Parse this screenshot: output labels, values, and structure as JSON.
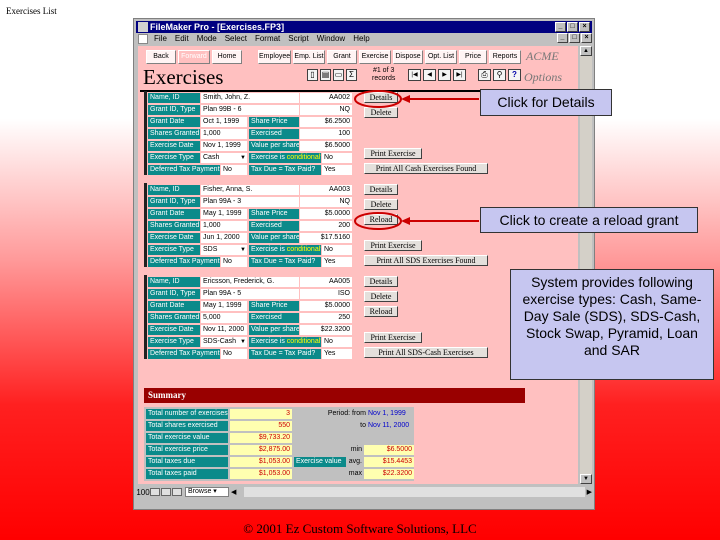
{
  "slide": {
    "title": "Exercises List",
    "footer": "© 2001 Ez Custom Software Solutions, LLC"
  },
  "window": {
    "title": "FileMaker Pro - [Exercises.FP3]",
    "menu": [
      "File",
      "Edit",
      "Mode",
      "Select",
      "Format",
      "Script",
      "Window",
      "Help"
    ],
    "window_buttons": [
      "_",
      "□",
      "×"
    ]
  },
  "toolbar": {
    "back": "Back",
    "forward": "Forward",
    "home": "Home",
    "tabs": [
      "Employee",
      "Emp. List",
      "Grant",
      "Exercise",
      "Dispose",
      "Opt. List",
      "Price",
      "Reports"
    ],
    "brand": "ACME",
    "options": "Options",
    "heading": "Exercises",
    "record_info_line1": "#1 of 3",
    "record_info_line2": "records",
    "doc_icons": [
      "new-record",
      "duplicate",
      "delete",
      "sum"
    ],
    "nav_icons": [
      "first",
      "prev",
      "next",
      "last"
    ],
    "tool_icons": [
      "print",
      "find",
      "help"
    ]
  },
  "labels": {
    "name_id": "Name, ID",
    "grant_id_type": "Grant ID, Type",
    "grant_date": "Grant Date",
    "share_price": "Share Price",
    "shares_granted": "Shares Granted",
    "exercised": "Exercised",
    "exercise_date": "Exercise Date",
    "value_per_share": "Value per share",
    "exercise_type": "Exercise Type",
    "exercise_is": "Exercise is ",
    "conditional": "conditional?",
    "deferred_tax": "Deferred Tax Payment?",
    "tax_due": "Tax Due = Tax Paid?"
  },
  "buttons": {
    "details": "Details",
    "delete": "Delete",
    "reload": "Reload",
    "print_exercise": "Print Exercise"
  },
  "records": [
    {
      "name": "Smith, John, Z.",
      "id": "AA002",
      "grant_id": "Plan 99B - 6",
      "type": "NQ",
      "grant_date": "Oct 1, 1999",
      "share_price": "$6.2500",
      "shares_granted": "1,000",
      "exercised": "100",
      "exercise_date": "Nov 1, 1999",
      "value_per_share": "$6.5000",
      "exercise_type": "Cash",
      "conditional": "No",
      "deferred": "No",
      "tax_due": "Yes",
      "print_all": "Print All Cash Exercises Found",
      "has_reload": false
    },
    {
      "name": "Fisher, Anna, S.",
      "id": "AA003",
      "grant_id": "Plan 99A - 3",
      "type": "NQ",
      "grant_date": "May 1, 1999",
      "share_price": "$5.0000",
      "shares_granted": "1,000",
      "exercised": "200",
      "exercise_date": "Jun 1, 2000",
      "value_per_share": "$17.5160",
      "exercise_type": "SDS",
      "conditional": "No",
      "deferred": "No",
      "tax_due": "Yes",
      "print_all": "Print All SDS Exercises Found",
      "has_reload": true
    },
    {
      "name": "Ericsson, Frederick, G.",
      "id": "AA005",
      "grant_id": "Plan 99A - 5",
      "type": "ISO",
      "grant_date": "May 1, 1999",
      "share_price": "$5.0000",
      "shares_granted": "5,000",
      "exercised": "250",
      "exercise_date": "Nov 11, 2000",
      "value_per_share": "$22.3200",
      "exercise_type": "SDS-Cash",
      "conditional": "No",
      "deferred": "No",
      "tax_due": "Yes",
      "print_all": "Print All SDS-Cash Exercises",
      "has_reload": true
    }
  ],
  "summary": {
    "title": "Summary",
    "rows": [
      {
        "label": "Total number of exercises",
        "value": "3"
      },
      {
        "label": "Total shares exercised",
        "value": "550"
      },
      {
        "label": "Total exercise value",
        "value": "$9,733.20"
      },
      {
        "label": "Total exercise price",
        "value": "$2,875.00"
      },
      {
        "label": "Total taxes due",
        "value": "$1,053.00"
      },
      {
        "label": "Total taxes paid",
        "value": "$1,053.00"
      }
    ],
    "period_label": "Period: from",
    "period_from": "Nov 1, 1999",
    "to_label": "to",
    "period_to": "Nov 11, 2000",
    "exercise_value_label": "Exercise value",
    "min_label": "min",
    "min": "$6.5000",
    "avg_label": "avg.",
    "avg": "$15.4453",
    "max_label": "max",
    "max": "$22.3200"
  },
  "status": {
    "zoom": "100",
    "mode": "Browse"
  },
  "callouts": {
    "details": "Click for Details",
    "reload": "Click to create a reload grant",
    "types": "System provides following exercise types: Cash, Same-Day Sale (SDS), SDS-Cash, Stock Swap, Pyramid, Loan and SAR"
  },
  "colors": {
    "label_bg": "#0b8a8a",
    "content_bg": "#ffc0c0",
    "summary_bar": "#990000",
    "callout_bg": "#c6c6f0",
    "arrow": "#cc0000"
  }
}
